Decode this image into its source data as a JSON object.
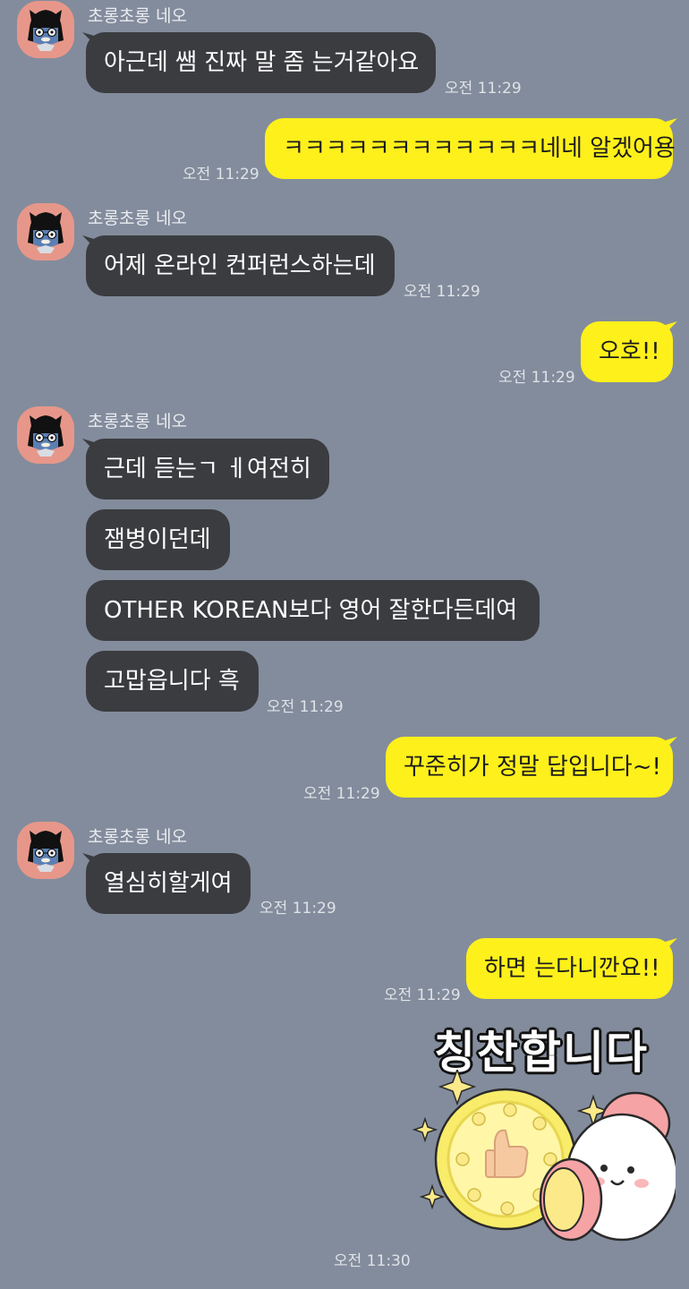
{
  "sender_name": "초롱초롱 네오",
  "messages": {
    "m1": {
      "text": "아근데 쌤 진짜 말 좀 는거같아요",
      "time": "오전 11:29"
    },
    "m2": {
      "text": "ㅋㅋㅋㅋㅋㅋㅋㅋㅋㅋㅋㅋ네네 알겠어용",
      "time": "오전 11:29"
    },
    "m3": {
      "text": "어제 온라인 컨퍼런스하는데",
      "time": "오전 11:29"
    },
    "m4": {
      "text": "오호!!",
      "time": "오전 11:29"
    },
    "m5": {
      "text": "근데 듣는ㄱ ㅔ여전히"
    },
    "m6": {
      "text": "잼병이던데"
    },
    "m7": {
      "text": "OTHER KOREAN보다 영어 잘한다든데여"
    },
    "m8": {
      "text": "고맙읍니다 흑",
      "time": "오전 11:29"
    },
    "m9": {
      "text": "꾸준히가 정말 답입니다~!",
      "time": "오전 11:29"
    },
    "m10": {
      "text": "열심히할게여",
      "time": "오전 11:29"
    },
    "m11": {
      "text": "하면 는다니깐요!!",
      "time": "오전 11:29"
    },
    "sticker": {
      "text": "칭찬합니다",
      "time": "오전 11:30"
    }
  },
  "colors": {
    "background": "#838c9c",
    "incoming_bubble": "#3b3c40",
    "outgoing_bubble": "#fef01b",
    "avatar_bg": "#e7978a"
  },
  "icons": {
    "avatar": "neo-character-avatar",
    "sticker": "thumbs-up-coin-sticker"
  }
}
